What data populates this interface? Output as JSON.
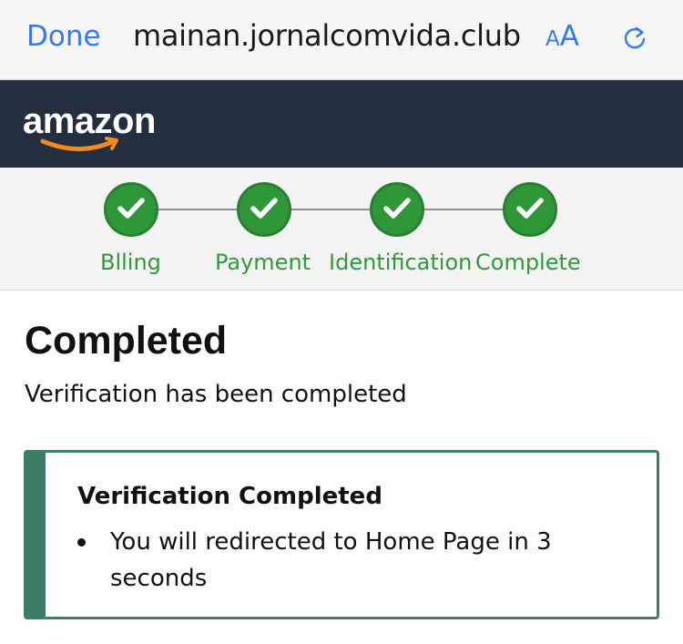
{
  "browser": {
    "done_label": "Done",
    "url": "mainan.jornalcomvida.club",
    "text_size_label_small": "A",
    "text_size_label_large": "A",
    "reload_icon": "reload-icon",
    "accent_color": "#3478f6"
  },
  "header": {
    "logo_text": "amazon",
    "background_color": "#232f3e"
  },
  "steps": {
    "items": [
      {
        "label": "Blling",
        "status": "complete"
      },
      {
        "label": "Payment",
        "status": "complete"
      },
      {
        "label": "Identification",
        "status": "complete"
      },
      {
        "label": "Complete",
        "status": "complete"
      }
    ],
    "color": "#2f9a3a"
  },
  "main": {
    "title": "Completed",
    "subtitle": "Verification has been completed",
    "alert": {
      "heading": "Verification Completed",
      "items": [
        "You will redirected to Home Page in 3 seconds"
      ],
      "accent_color": "#3c7d68"
    }
  }
}
